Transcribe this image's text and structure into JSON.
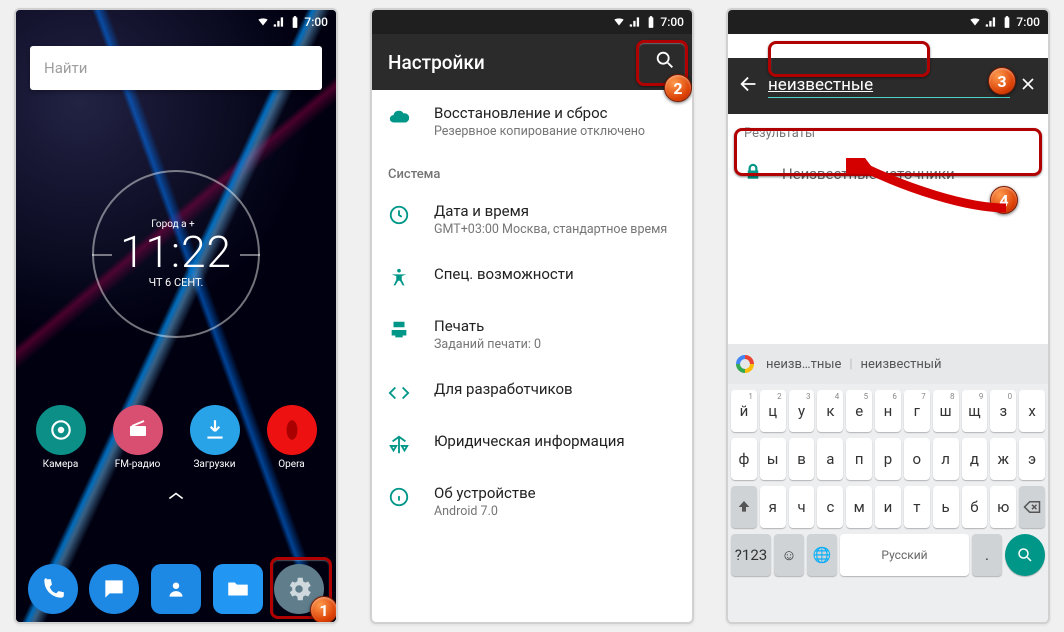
{
  "status": {
    "time": "7:00"
  },
  "panel1": {
    "search_placeholder": "Найти",
    "clock": {
      "weather": "Город а +",
      "time": "11:22",
      "date": "ЧТ 6 СЕНТ."
    },
    "apps": [
      {
        "label": "Камера",
        "name": "camera"
      },
      {
        "label": "FM-радио",
        "name": "fm-radio"
      },
      {
        "label": "Загрузки",
        "name": "downloads"
      },
      {
        "label": "Opera",
        "name": "opera"
      }
    ],
    "dock": [
      {
        "name": "phone"
      },
      {
        "name": "messages"
      },
      {
        "name": "contacts"
      },
      {
        "name": "files"
      },
      {
        "name": "settings"
      }
    ]
  },
  "panel2": {
    "title": "Настройки",
    "items": [
      {
        "icon": "cloud",
        "title": "Восстановление и сброс",
        "sub": "Резервное копирование отключено"
      }
    ],
    "section": "Система",
    "system_items": [
      {
        "icon": "clock",
        "title": "Дата и время",
        "sub": "GMT+03:00 Москва, стандартное время"
      },
      {
        "icon": "a11y",
        "title": "Спец. возможности",
        "sub": ""
      },
      {
        "icon": "print",
        "title": "Печать",
        "sub": "Заданий печати: 0"
      },
      {
        "icon": "dev",
        "title": "Для разработчиков",
        "sub": ""
      },
      {
        "icon": "legal",
        "title": "Юридическая информация",
        "sub": ""
      },
      {
        "icon": "about",
        "title": "Об устройстве",
        "sub": "Android 7.0"
      }
    ]
  },
  "panel3": {
    "query": "неизвестные",
    "results_header": "Результаты",
    "result": "Неизвестные источники",
    "suggestions": [
      "неизв…тные",
      "неизвестный"
    ],
    "keyboard": {
      "row1": [
        "й",
        "ц",
        "у",
        "к",
        "е",
        "н",
        "г",
        "ш",
        "щ",
        "з",
        "х"
      ],
      "row1_hints": [
        "1",
        "2",
        "3",
        "4",
        "5",
        "6",
        "7",
        "8",
        "9",
        "0",
        ""
      ],
      "row2": [
        "ф",
        "ы",
        "в",
        "а",
        "п",
        "р",
        "о",
        "л",
        "д",
        "ж",
        "э"
      ],
      "row3": [
        "я",
        "ч",
        "с",
        "м",
        "и",
        "т",
        "ь",
        "б",
        "ю"
      ],
      "space_label": "Русский",
      "symbols_label": "?123"
    }
  },
  "badges": {
    "b1": "1",
    "b2": "2",
    "b3": "3",
    "b4": "4"
  }
}
